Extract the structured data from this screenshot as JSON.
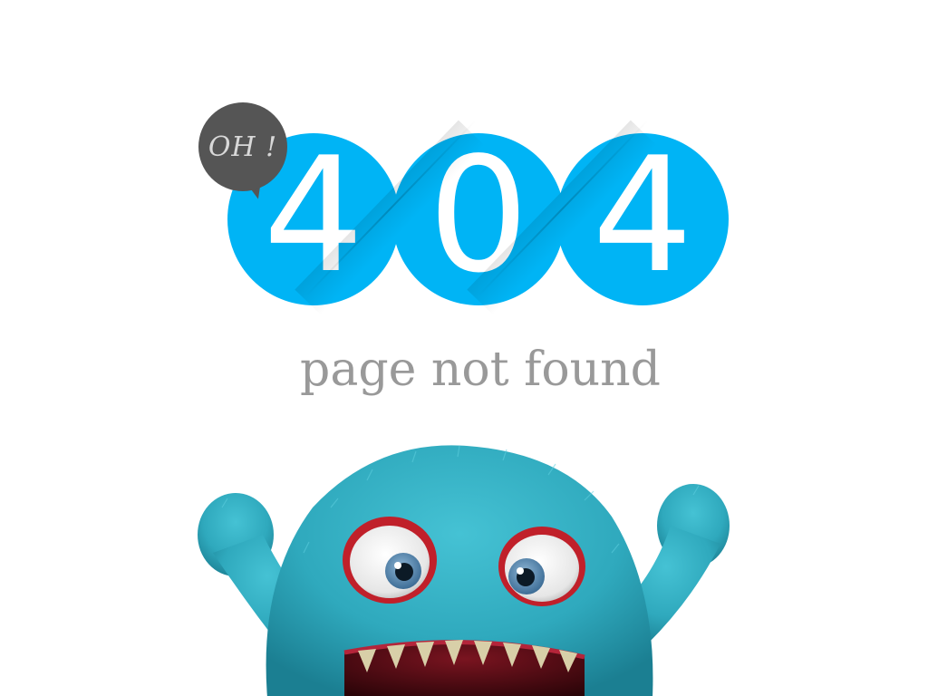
{
  "colors": {
    "accent": "#00b4f5",
    "bubble": "#555555",
    "bubble_text": "#d8d8d8",
    "subtitle": "#999999",
    "fur": "#2fa9bd",
    "fur_dark": "#1b7f92",
    "eye_rim": "#c0202a"
  },
  "bubble": {
    "text": "OH !"
  },
  "error_code": {
    "digits": [
      "4",
      "0",
      "4"
    ]
  },
  "message": {
    "text": "page not found"
  },
  "illustration": {
    "icon": "monster-icon"
  }
}
